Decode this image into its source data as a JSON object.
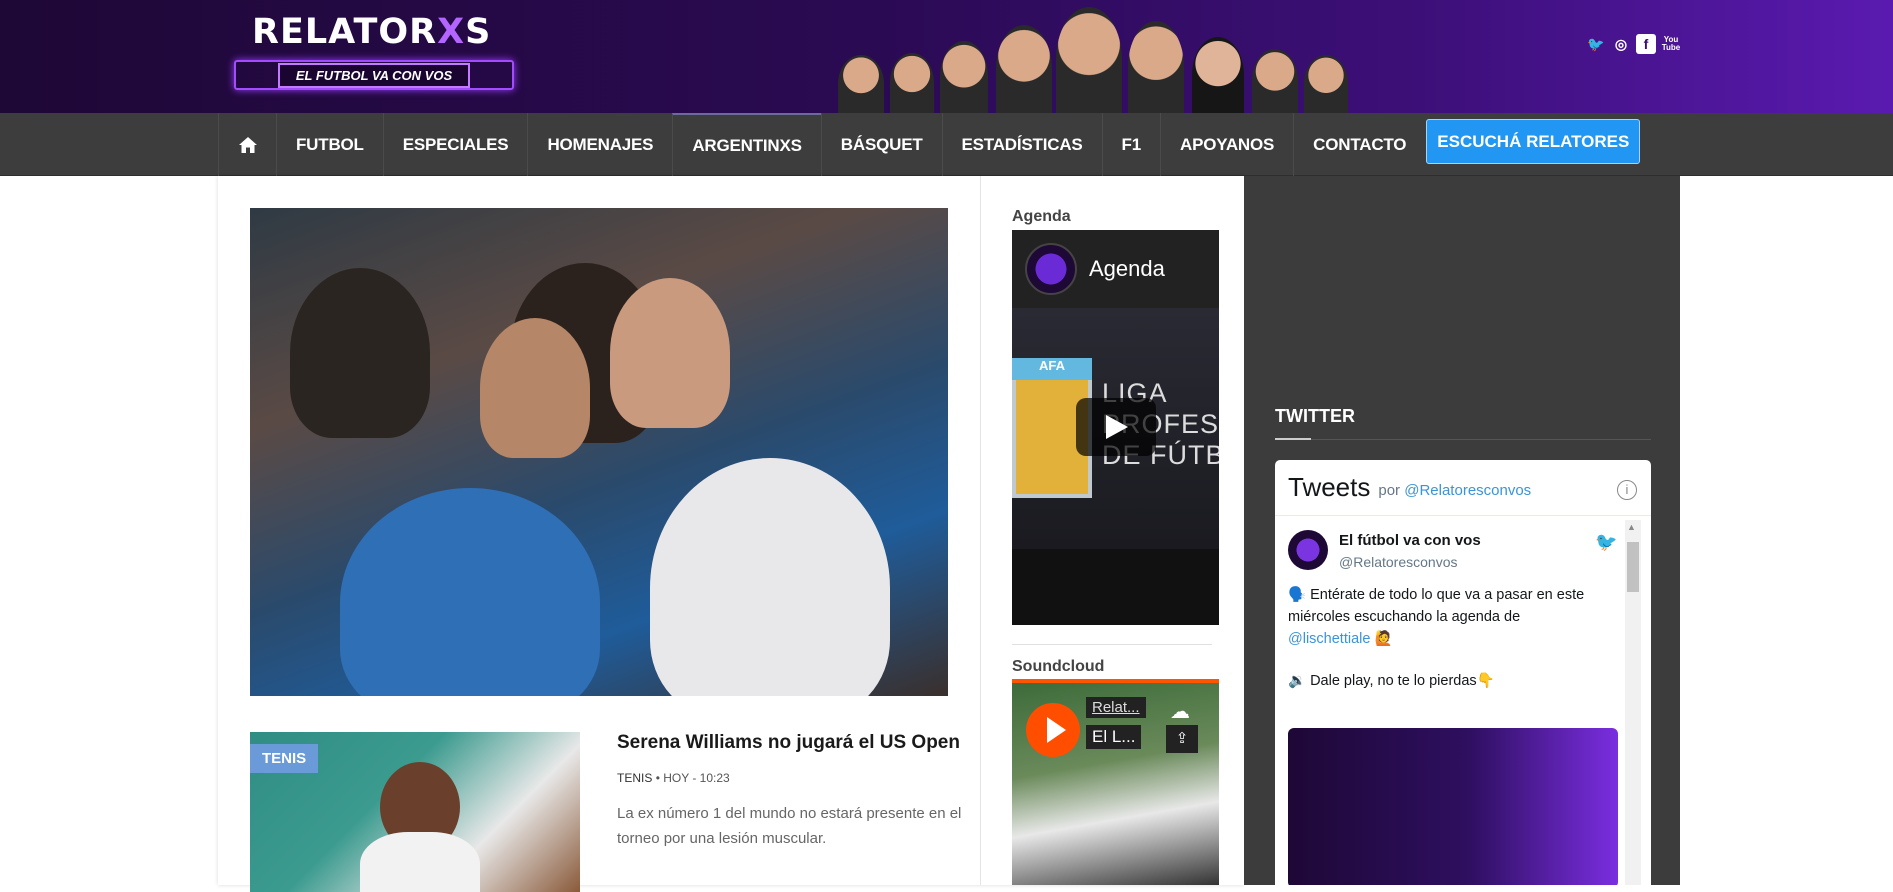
{
  "brand": {
    "logo_main": "RELATOR",
    "logo_x": "X",
    "logo_s": "S",
    "tagline": "EL FUTBOL VA CON VOS"
  },
  "social": {
    "twitter": "🐦",
    "instagram": "◎",
    "facebook": "f",
    "youtube": "You Tube"
  },
  "nav": {
    "items": [
      "FUTBOL",
      "ESPECIALES",
      "HOMENAJES",
      "ARGENTINXS",
      "BÁSQUET",
      "ESTADÍSTICAS",
      "F1",
      "APOYANOS",
      "CONTACTO"
    ],
    "cta": "ESCUCHÁ RELATORES"
  },
  "article": {
    "tag": "TENIS",
    "title": "Serena Williams no jugará el US Open",
    "meta_category": "TENIS",
    "meta_time": "• HOY - 10:23",
    "description": "La ex número 1 del mundo no estará presente en el torneo por una lesión muscular."
  },
  "agenda": {
    "heading": "Agenda",
    "player_title": "Agenda",
    "poster_band": "AFA",
    "poster_text_1": "LIGA",
    "poster_text_2": "PROFESION",
    "poster_text_3": "DE FÚTBOL"
  },
  "soundcloud": {
    "heading": "Soundcloud",
    "chip1": "Relat...",
    "chip2": "El L..."
  },
  "twitter": {
    "section": "TWITTER",
    "title": "Tweets",
    "by": "por",
    "by_handle": "@Relatoresconvos",
    "name": "El fútbol va con vos",
    "handle": "@Relatoresconvos",
    "text_1": "🗣️ Entérate de todo lo que va a pasar en este miércoles escuchando la agenda de",
    "mention": "@lischettiale",
    "emoji_after": "🙋",
    "text_2": "🔉 Dale play, no te lo pierdas👇"
  }
}
